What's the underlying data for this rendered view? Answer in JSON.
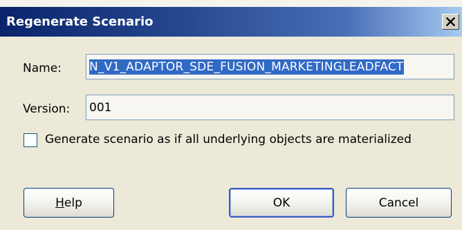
{
  "dialog": {
    "title": "Regenerate Scenario",
    "close_symbol": "✕"
  },
  "form": {
    "name_label": "Name:",
    "name_value": "N_V1_ADAPTOR_SDE_FUSION_MARKETINGLEADFACT",
    "version_label": "Version:",
    "version_value": "001",
    "materialize_label": "Generate scenario as if all underlying objects are materialized",
    "materialize_checked": false
  },
  "buttons": {
    "help_mnemonic": "H",
    "help_rest": "elp",
    "ok": "OK",
    "cancel": "Cancel"
  },
  "colors": {
    "titlebar_start": "#0a246a",
    "titlebar_end": "#a6caf0",
    "selection": "#316ac5",
    "dialog_bg": "#ece9d8"
  }
}
